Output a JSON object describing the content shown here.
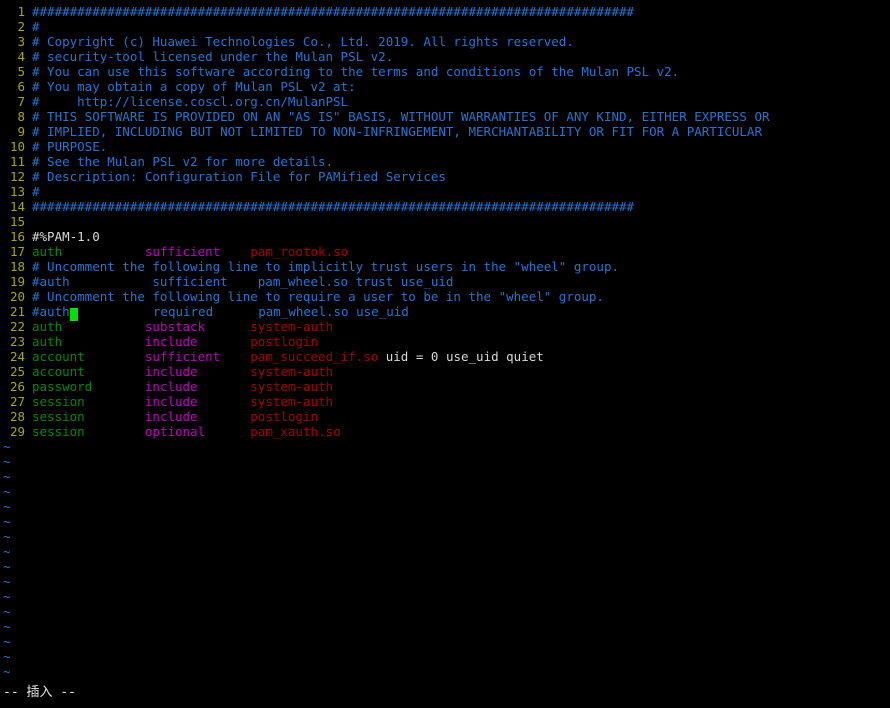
{
  "editor": {
    "name": "vim",
    "mode_label": "-- 插入 --",
    "colors": {
      "background": "#000000",
      "line_number": "#a8a800",
      "comment": "#2176d4",
      "normal_text": "#d8d8d8",
      "pam_type": "#008a00",
      "pam_control": "#c000c0",
      "pam_module": "#a80000",
      "cursor": "#00e000",
      "tilde": "#2176d4",
      "status_text": "#e8e8e8"
    },
    "cursor": {
      "line": 21,
      "column": 5
    },
    "total_lines": 29,
    "filler_rows": 16
  },
  "lines": [
    {
      "num": "1",
      "segments": [
        {
          "text": "################################################################################",
          "cls": "c-comment"
        }
      ]
    },
    {
      "num": "2",
      "segments": [
        {
          "text": "#",
          "cls": "c-comment"
        }
      ]
    },
    {
      "num": "3",
      "segments": [
        {
          "text": "# Copyright (c) Huawei Technologies Co., Ltd. 2019. All rights reserved.",
          "cls": "c-comment"
        }
      ]
    },
    {
      "num": "4",
      "segments": [
        {
          "text": "# security-tool licensed under the Mulan PSL v2.",
          "cls": "c-comment"
        }
      ]
    },
    {
      "num": "5",
      "segments": [
        {
          "text": "# You can use this software according to the terms and conditions of the Mulan PSL v2.",
          "cls": "c-comment"
        }
      ]
    },
    {
      "num": "6",
      "segments": [
        {
          "text": "# You may obtain a copy of Mulan PSL v2 at:",
          "cls": "c-comment"
        }
      ]
    },
    {
      "num": "7",
      "segments": [
        {
          "text": "#     http://license.coscl.org.cn/MulanPSL",
          "cls": "c-comment"
        }
      ]
    },
    {
      "num": "8",
      "segments": [
        {
          "text": "# THIS SOFTWARE IS PROVIDED ON AN \"AS IS\" BASIS, WITHOUT WARRANTIES OF ANY KIND, EITHER EXPRESS OR",
          "cls": "c-comment"
        }
      ]
    },
    {
      "num": "9",
      "segments": [
        {
          "text": "# IMPLIED, INCLUDING BUT NOT LIMITED TO NON-INFRINGEMENT, MERCHANTABILITY OR FIT FOR A PARTICULAR",
          "cls": "c-comment"
        }
      ]
    },
    {
      "num": "10",
      "segments": [
        {
          "text": "# PURPOSE.",
          "cls": "c-comment"
        }
      ]
    },
    {
      "num": "11",
      "segments": [
        {
          "text": "# See the Mulan PSL v2 for more details.",
          "cls": "c-comment"
        }
      ]
    },
    {
      "num": "12",
      "segments": [
        {
          "text": "# Description: Configuration File for PAMified Services",
          "cls": "c-comment"
        }
      ]
    },
    {
      "num": "13",
      "segments": [
        {
          "text": "#",
          "cls": "c-comment"
        }
      ]
    },
    {
      "num": "14",
      "segments": [
        {
          "text": "################################################################################",
          "cls": "c-comment"
        }
      ]
    },
    {
      "num": "15",
      "segments": []
    },
    {
      "num": "16",
      "segments": [
        {
          "text": "#%PAM-1.0",
          "cls": "c-plain"
        }
      ]
    },
    {
      "num": "17",
      "segments": [
        {
          "text": "auth",
          "cls": "c-type"
        },
        {
          "text": "           ",
          "cls": "c-plain"
        },
        {
          "text": "sufficient",
          "cls": "c-ctrl"
        },
        {
          "text": "    ",
          "cls": "c-plain"
        },
        {
          "text": "pam_rootok.so",
          "cls": "c-module"
        }
      ]
    },
    {
      "num": "18",
      "segments": [
        {
          "text": "# Uncomment the following line to implicitly trust users in the \"wheel\" group.",
          "cls": "c-comment"
        }
      ]
    },
    {
      "num": "19",
      "segments": [
        {
          "text": "#auth           sufficient    pam_wheel.so trust use_uid",
          "cls": "c-comment"
        }
      ]
    },
    {
      "num": "20",
      "segments": [
        {
          "text": "# Uncomment the following line to require a user to be in the \"wheel\" group.",
          "cls": "c-comment"
        }
      ]
    },
    {
      "num": "21",
      "segments": [
        {
          "text": "#auth",
          "cls": "c-comment"
        },
        {
          "cursor": true
        },
        {
          "text": "          required      pam_wheel.so use_uid",
          "cls": "c-comment"
        }
      ]
    },
    {
      "num": "22",
      "segments": [
        {
          "text": "auth",
          "cls": "c-type"
        },
        {
          "text": "           ",
          "cls": "c-plain"
        },
        {
          "text": "substack",
          "cls": "c-ctrl"
        },
        {
          "text": "      ",
          "cls": "c-plain"
        },
        {
          "text": "system-auth",
          "cls": "c-module"
        }
      ]
    },
    {
      "num": "23",
      "segments": [
        {
          "text": "auth",
          "cls": "c-type"
        },
        {
          "text": "           ",
          "cls": "c-plain"
        },
        {
          "text": "include",
          "cls": "c-ctrl"
        },
        {
          "text": "       ",
          "cls": "c-plain"
        },
        {
          "text": "postlogin",
          "cls": "c-module"
        }
      ]
    },
    {
      "num": "24",
      "segments": [
        {
          "text": "account",
          "cls": "c-type"
        },
        {
          "text": "        ",
          "cls": "c-plain"
        },
        {
          "text": "sufficient",
          "cls": "c-ctrl"
        },
        {
          "text": "    ",
          "cls": "c-plain"
        },
        {
          "text": "pam_succeed_if.so",
          "cls": "c-module"
        },
        {
          "text": " uid = 0 use_uid quiet",
          "cls": "c-plain"
        }
      ]
    },
    {
      "num": "25",
      "segments": [
        {
          "text": "account",
          "cls": "c-type"
        },
        {
          "text": "        ",
          "cls": "c-plain"
        },
        {
          "text": "include",
          "cls": "c-ctrl"
        },
        {
          "text": "       ",
          "cls": "c-plain"
        },
        {
          "text": "system-auth",
          "cls": "c-module"
        }
      ]
    },
    {
      "num": "26",
      "segments": [
        {
          "text": "password",
          "cls": "c-type"
        },
        {
          "text": "       ",
          "cls": "c-plain"
        },
        {
          "text": "include",
          "cls": "c-ctrl"
        },
        {
          "text": "       ",
          "cls": "c-plain"
        },
        {
          "text": "system-auth",
          "cls": "c-module"
        }
      ]
    },
    {
      "num": "27",
      "segments": [
        {
          "text": "session",
          "cls": "c-type"
        },
        {
          "text": "        ",
          "cls": "c-plain"
        },
        {
          "text": "include",
          "cls": "c-ctrl"
        },
        {
          "text": "       ",
          "cls": "c-plain"
        },
        {
          "text": "system-auth",
          "cls": "c-module"
        }
      ]
    },
    {
      "num": "28",
      "segments": [
        {
          "text": "session",
          "cls": "c-type"
        },
        {
          "text": "        ",
          "cls": "c-plain"
        },
        {
          "text": "include",
          "cls": "c-ctrl"
        },
        {
          "text": "       ",
          "cls": "c-plain"
        },
        {
          "text": "postlogin",
          "cls": "c-module"
        }
      ]
    },
    {
      "num": "29",
      "segments": [
        {
          "text": "session",
          "cls": "c-type"
        },
        {
          "text": "        ",
          "cls": "c-plain"
        },
        {
          "text": "optional",
          "cls": "c-ctrl"
        },
        {
          "text": "      ",
          "cls": "c-plain"
        },
        {
          "text": "pam_xauth.so",
          "cls": "c-module"
        }
      ]
    }
  ],
  "tilde_glyph": "~"
}
